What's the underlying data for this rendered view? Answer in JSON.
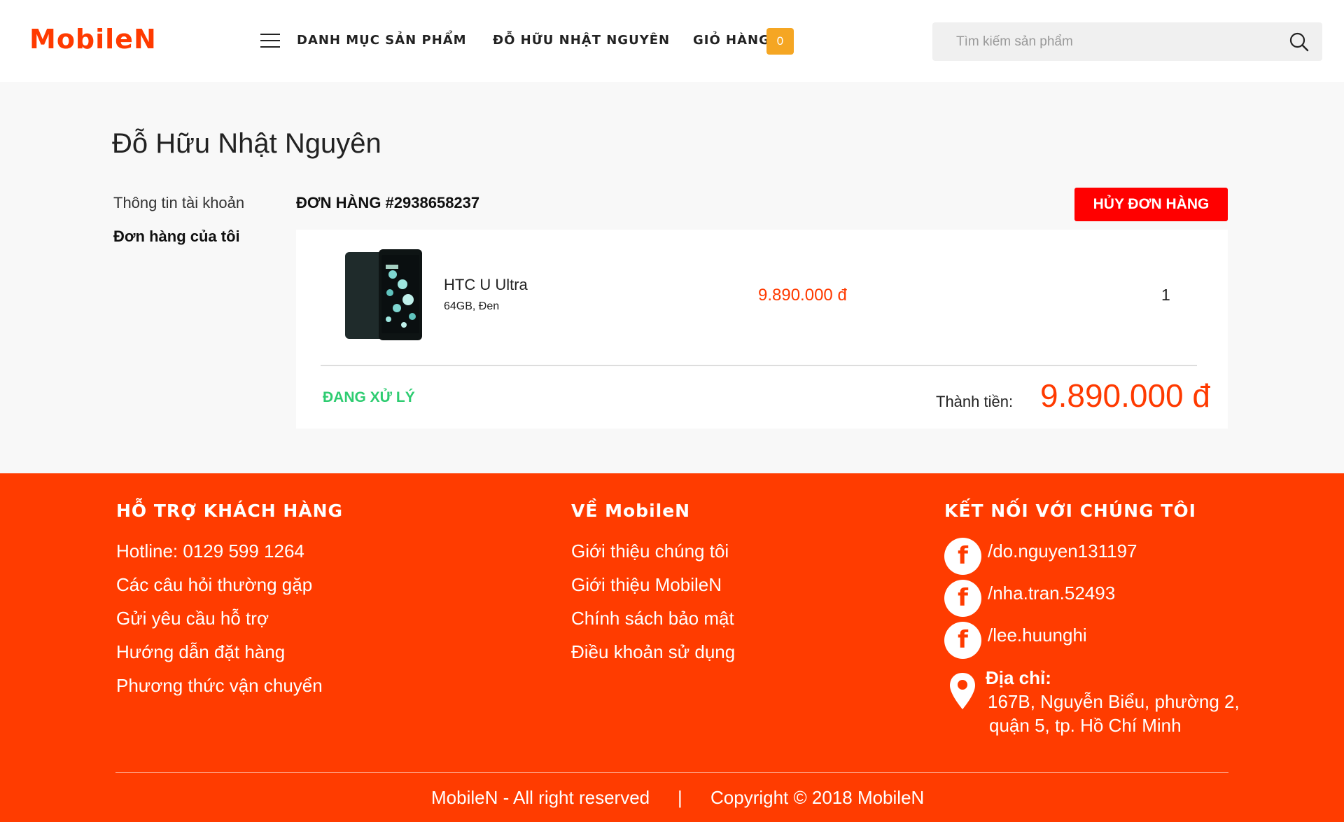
{
  "header": {
    "logo": "MobileN",
    "nav_categories": "DANH MỤC SẢN PHẨM",
    "nav_user": "ĐỖ HỮU NHẬT NGUYÊN",
    "nav_cart": "GIỎ HÀNG",
    "cart_count": "0",
    "search_placeholder": "Tìm kiếm sản phẩm"
  },
  "page": {
    "title": "Đỗ Hữu Nhật Nguyên"
  },
  "sidebar": {
    "items": [
      {
        "label": "Thông tin tài khoản"
      },
      {
        "label": "Đơn hàng của tôi"
      }
    ]
  },
  "order": {
    "id_label": "ĐƠN HÀNG #2938658237",
    "cancel_label": "HỦY ĐƠN HÀNG",
    "item": {
      "name": "HTC U Ultra",
      "variant": "64GB, Đen",
      "price": "9.890.000 đ",
      "quantity": "1"
    },
    "status": "ĐANG XỬ LÝ",
    "total_label": "Thành tiền:",
    "total_value": "9.890.000 đ"
  },
  "footer": {
    "support": {
      "heading": "HỖ TRỢ KHÁCH HÀNG",
      "links": [
        "Hotline: 0129 599 1264",
        "Các câu hỏi thường gặp",
        "Gửi yêu cầu hỗ trợ",
        "Hướng dẫn đặt hàng",
        "Phương thức vận chuyển"
      ]
    },
    "about": {
      "heading": "VỀ MobileN",
      "links": [
        "Giới thiệu chúng tôi",
        "Giới thiệu MobileN",
        "Chính sách bảo mật",
        "Điều khoản sử dụng"
      ]
    },
    "connect": {
      "heading": "KẾT NỐI VỚI CHÚNG TÔI",
      "facebook": [
        "/do.nguyen131197",
        "/nha.tran.52493",
        "/lee.huunghi"
      ],
      "fb_glyph": "f",
      "address_label": "Địa chỉ:",
      "address_lines": [
        "167B, Nguyễn Biểu, phường 2,",
        "quận 5, tp. Hồ Chí Minh"
      ]
    },
    "bottom": {
      "rights": "MobileN - All right reserved",
      "separator": "|",
      "copyright": "Copyright © 2018 MobileN"
    }
  },
  "colors": {
    "brand": "#ff3a00",
    "footer_bg": "#ff3c00",
    "cart_badge": "#f5a623",
    "cancel_button": "#ff0000",
    "status": "#2ecc71"
  }
}
